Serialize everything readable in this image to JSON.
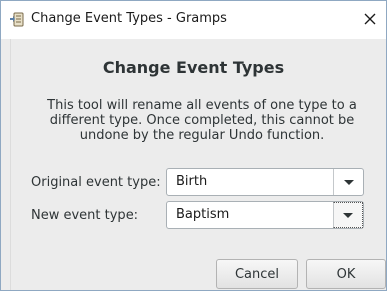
{
  "window": {
    "title": "Change Event Types - Gramps"
  },
  "dialog": {
    "heading": "Change Event Types",
    "description": "This tool will rename all events of one type to a different type. Once completed, this cannot be undone by the regular Undo function."
  },
  "fields": {
    "original": {
      "label": "Original event type:",
      "value": "Birth"
    },
    "new": {
      "label": "New event type:",
      "value": "Baptism"
    }
  },
  "buttons": {
    "cancel": "Cancel",
    "ok": "OK"
  },
  "icons": {
    "app": "gramps-tool-icon",
    "close": "close-icon",
    "dropdown": "chevron-down-icon"
  }
}
